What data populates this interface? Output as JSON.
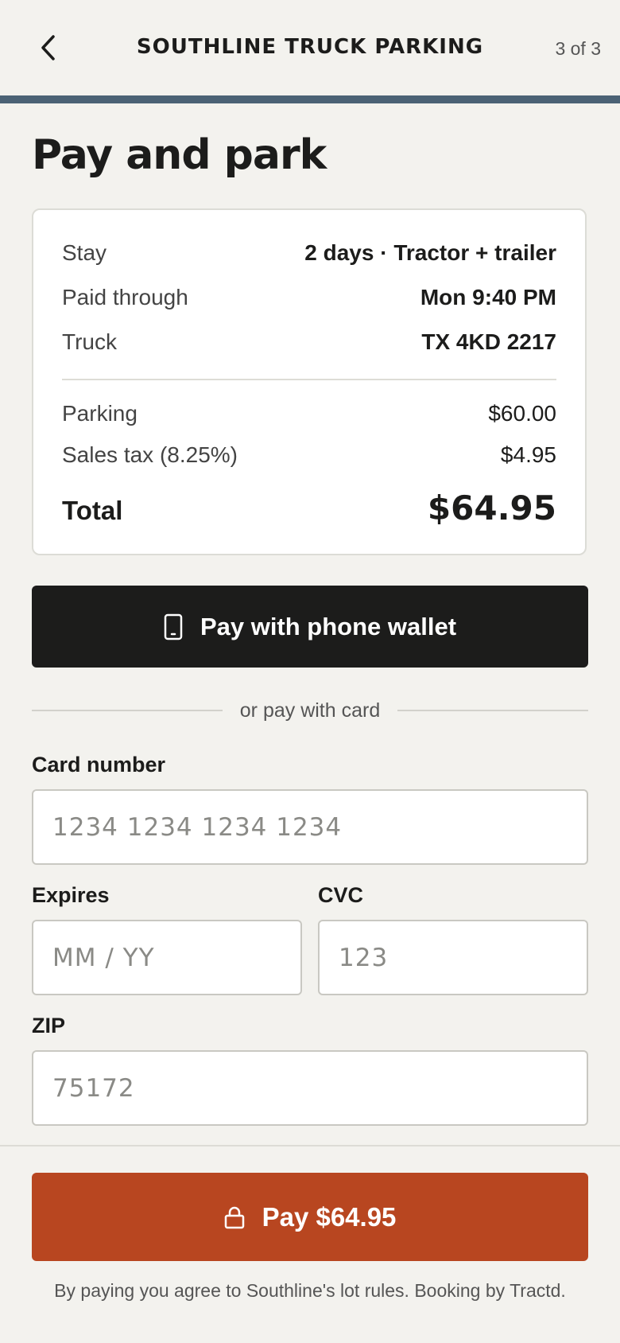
{
  "header": {
    "title": "SOUTHLINE TRUCK PARKING",
    "step": "3 of 3",
    "accent_color": "#4b6275"
  },
  "page": {
    "title": "Pay and park"
  },
  "summary": {
    "details": [
      {
        "label": "Stay",
        "value": "2 days · Tractor + trailer"
      },
      {
        "label": "Paid through",
        "value": "Mon 9:40 PM"
      },
      {
        "label": "Truck",
        "value": "TX 4KD 2217"
      }
    ],
    "charges": [
      {
        "label": "Parking",
        "value": "$60.00"
      },
      {
        "label": "Sales tax (8.25%)",
        "value": "$4.95"
      }
    ],
    "total_label": "Total",
    "total_value": "$64.95"
  },
  "wallet": {
    "label": "Pay with phone wallet",
    "icon": "phone-icon"
  },
  "divider_text": "or pay with card",
  "card_form": {
    "card_number": {
      "label": "Card number",
      "placeholder": "1234 1234 1234 1234",
      "value": ""
    },
    "expires": {
      "label": "Expires",
      "placeholder": "MM / YY",
      "value": ""
    },
    "cvc": {
      "label": "CVC",
      "placeholder": "123",
      "value": ""
    },
    "zip": {
      "label": "ZIP",
      "placeholder": "75172",
      "value": ""
    }
  },
  "pay_button": {
    "label": "Pay $64.95",
    "icon": "lock-icon",
    "color": "#b84620"
  },
  "legal_text": "By paying you agree to Southline's lot rules. Booking by Tractd."
}
